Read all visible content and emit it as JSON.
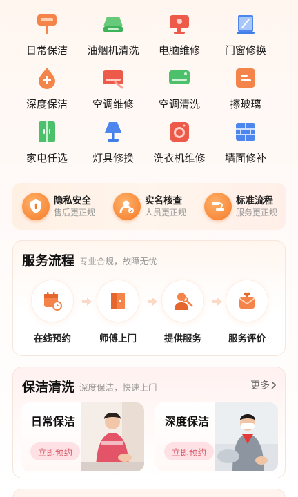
{
  "categories": [
    {
      "label": "日常保洁",
      "icon": "housekeeping-icon"
    },
    {
      "label": "油烟机清洗",
      "icon": "range-hood-icon"
    },
    {
      "label": "电脑维修",
      "icon": "computer-repair-icon"
    },
    {
      "label": "门窗修换",
      "icon": "window-icon"
    },
    {
      "label": "深度保洁",
      "icon": "deep-clean-drop-icon"
    },
    {
      "label": "空调维修",
      "icon": "ac-repair-icon"
    },
    {
      "label": "空调清洗",
      "icon": "ac-clean-icon"
    },
    {
      "label": "擦玻璃",
      "icon": "glass-wipe-icon"
    },
    {
      "label": "家电任选",
      "icon": "fridge-icon"
    },
    {
      "label": "灯具修换",
      "icon": "lamp-icon"
    },
    {
      "label": "洗衣机维修",
      "icon": "washing-machine-icon"
    },
    {
      "label": "墙面修补",
      "icon": "brick-wall-icon"
    }
  ],
  "guarantee": [
    {
      "title": "隐私安全",
      "sub": "售后更正规",
      "icon": "shield-icon"
    },
    {
      "title": "实名核查",
      "sub": "人员更正规",
      "icon": "user-verified-icon"
    },
    {
      "title": "标准流程",
      "sub": "服务更正规",
      "icon": "process-icon"
    }
  ],
  "flow": {
    "title": "服务流程",
    "subtitle": "专业合规，故障无忧",
    "steps": [
      {
        "label": "在线预约",
        "icon": "calendar-clock-icon"
      },
      {
        "label": "师傅上门",
        "icon": "door-icon"
      },
      {
        "label": "提供服务",
        "icon": "technician-icon"
      },
      {
        "label": "服务评价",
        "icon": "review-envelope-icon"
      }
    ]
  },
  "cleaning": {
    "title": "保洁清洗",
    "subtitle": "深度保洁，快速上门",
    "more": "更多",
    "services": [
      {
        "title": "日常保洁",
        "button": "立即预约"
      },
      {
        "title": "深度保洁",
        "button": "立即预约"
      }
    ]
  },
  "colors": {
    "accent_orange": "#f47a2a",
    "icon_red": "#ee5a4a",
    "icon_green": "#4cc06a",
    "icon_blue": "#3f7ee8",
    "button_pink": "#fde1e4"
  }
}
